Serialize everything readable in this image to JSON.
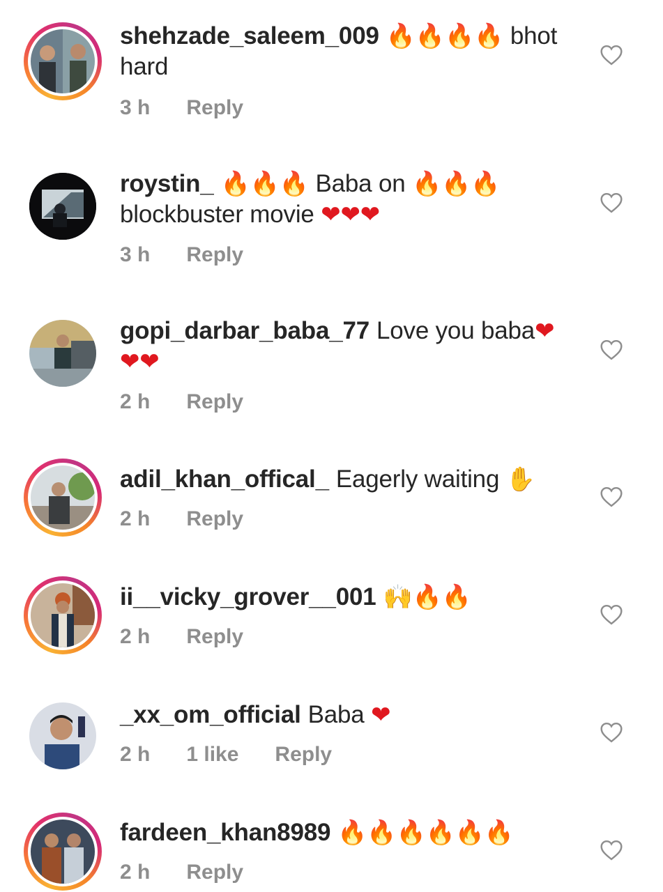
{
  "comments": [
    {
      "username": "shehzade_saleem_009",
      "text": "bhot hard",
      "emoji_before": "🔥🔥🔥🔥",
      "time": "3 h",
      "reply": "Reply"
    },
    {
      "username": "roystin_",
      "text1": "Baba on",
      "text2": "blockbuster movie",
      "emoji_a": "🔥🔥🔥",
      "emoji_b": "🔥🔥🔥",
      "emoji_c": "❤❤❤",
      "time": "3 h",
      "reply": "Reply"
    },
    {
      "username": "gopi_darbar_baba_77",
      "text": "Love you baba",
      "emoji": "❤",
      "emoji2": "❤❤",
      "time": "2 h",
      "reply": "Reply"
    },
    {
      "username": "adil_khan_offical_",
      "text": "Eagerly waiting",
      "emoji": "✋",
      "time": "2 h",
      "reply": "Reply"
    },
    {
      "username": "ii__vicky_grover__001",
      "emoji": "🙌🔥🔥",
      "time": "2 h",
      "reply": "Reply"
    },
    {
      "username": "_xx_om_official",
      "text": "Baba",
      "emoji": "❤",
      "time": "2 h",
      "likes": "1 like",
      "reply": "Reply"
    },
    {
      "username": "fardeen_khan8989",
      "emoji": "🔥🔥🔥🔥🔥🔥",
      "time": "2 h",
      "reply": "Reply"
    }
  ],
  "colors": {
    "text": "#262626",
    "meta": "#8e8e8e",
    "story_ring": "#e1306c",
    "heart_outline": "#8e8e8e"
  },
  "icons": {
    "like": "heart-outline-icon"
  }
}
